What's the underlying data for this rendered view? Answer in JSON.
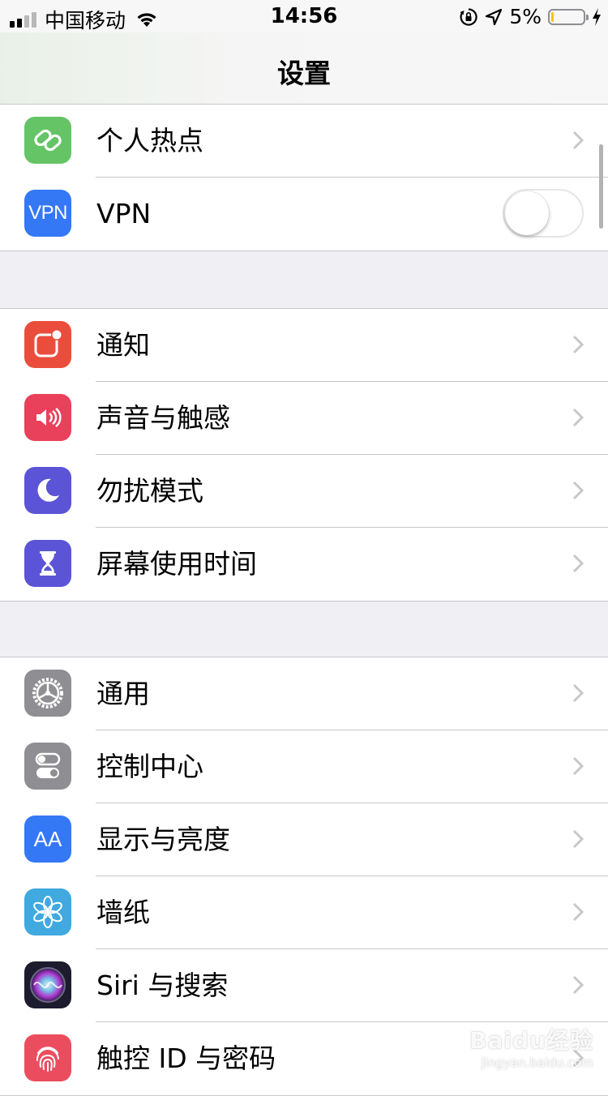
{
  "status_bar": {
    "carrier": "中国移动",
    "time": "14:56",
    "battery_percent": "5%",
    "battery_level": 0.05,
    "signal_bars": 4,
    "signal_bars_active": 2
  },
  "nav": {
    "title": "设置"
  },
  "groups": [
    {
      "items": [
        {
          "label": "个人热点",
          "icon": "personal-hotspot-icon",
          "color": "#65c466",
          "accessory": "chevron"
        },
        {
          "label": "VPN",
          "icon": "vpn-icon",
          "icon_text": "VPN",
          "color": "#3478f6",
          "accessory": "toggle",
          "toggle_on": false
        }
      ]
    },
    {
      "items": [
        {
          "label": "通知",
          "icon": "notifications-icon",
          "color": "#eb4d3d",
          "accessory": "chevron"
        },
        {
          "label": "声音与触感",
          "icon": "sounds-icon",
          "color": "#e9405c",
          "accessory": "chevron"
        },
        {
          "label": "勿扰模式",
          "icon": "moon-icon",
          "color": "#5c54d6",
          "accessory": "chevron"
        },
        {
          "label": "屏幕使用时间",
          "icon": "hourglass-icon",
          "color": "#5c54d6",
          "accessory": "chevron"
        }
      ]
    },
    {
      "items": [
        {
          "label": "通用",
          "icon": "gear-icon",
          "color": "#8e8e93",
          "accessory": "chevron"
        },
        {
          "label": "控制中心",
          "icon": "control-center-icon",
          "color": "#8e8e93",
          "accessory": "chevron"
        },
        {
          "label": "显示与亮度",
          "icon": "display-brightness-icon",
          "icon_text": "AA",
          "color": "#3478f6",
          "accessory": "chevron"
        },
        {
          "label": "墙纸",
          "icon": "wallpaper-flower-icon",
          "color": "#3fa9e0",
          "accessory": "chevron"
        },
        {
          "label": "Siri 与搜索",
          "icon": "siri-icon",
          "color": "#1c1c2e",
          "accessory": "chevron"
        },
        {
          "label": "触控 ID 与密码",
          "icon": "fingerprint-icon",
          "color": "#eb4d5f",
          "accessory": "chevron"
        }
      ]
    }
  ],
  "watermark": {
    "line1": "Baidu经验",
    "line2": "jingyan.baidu.com"
  }
}
